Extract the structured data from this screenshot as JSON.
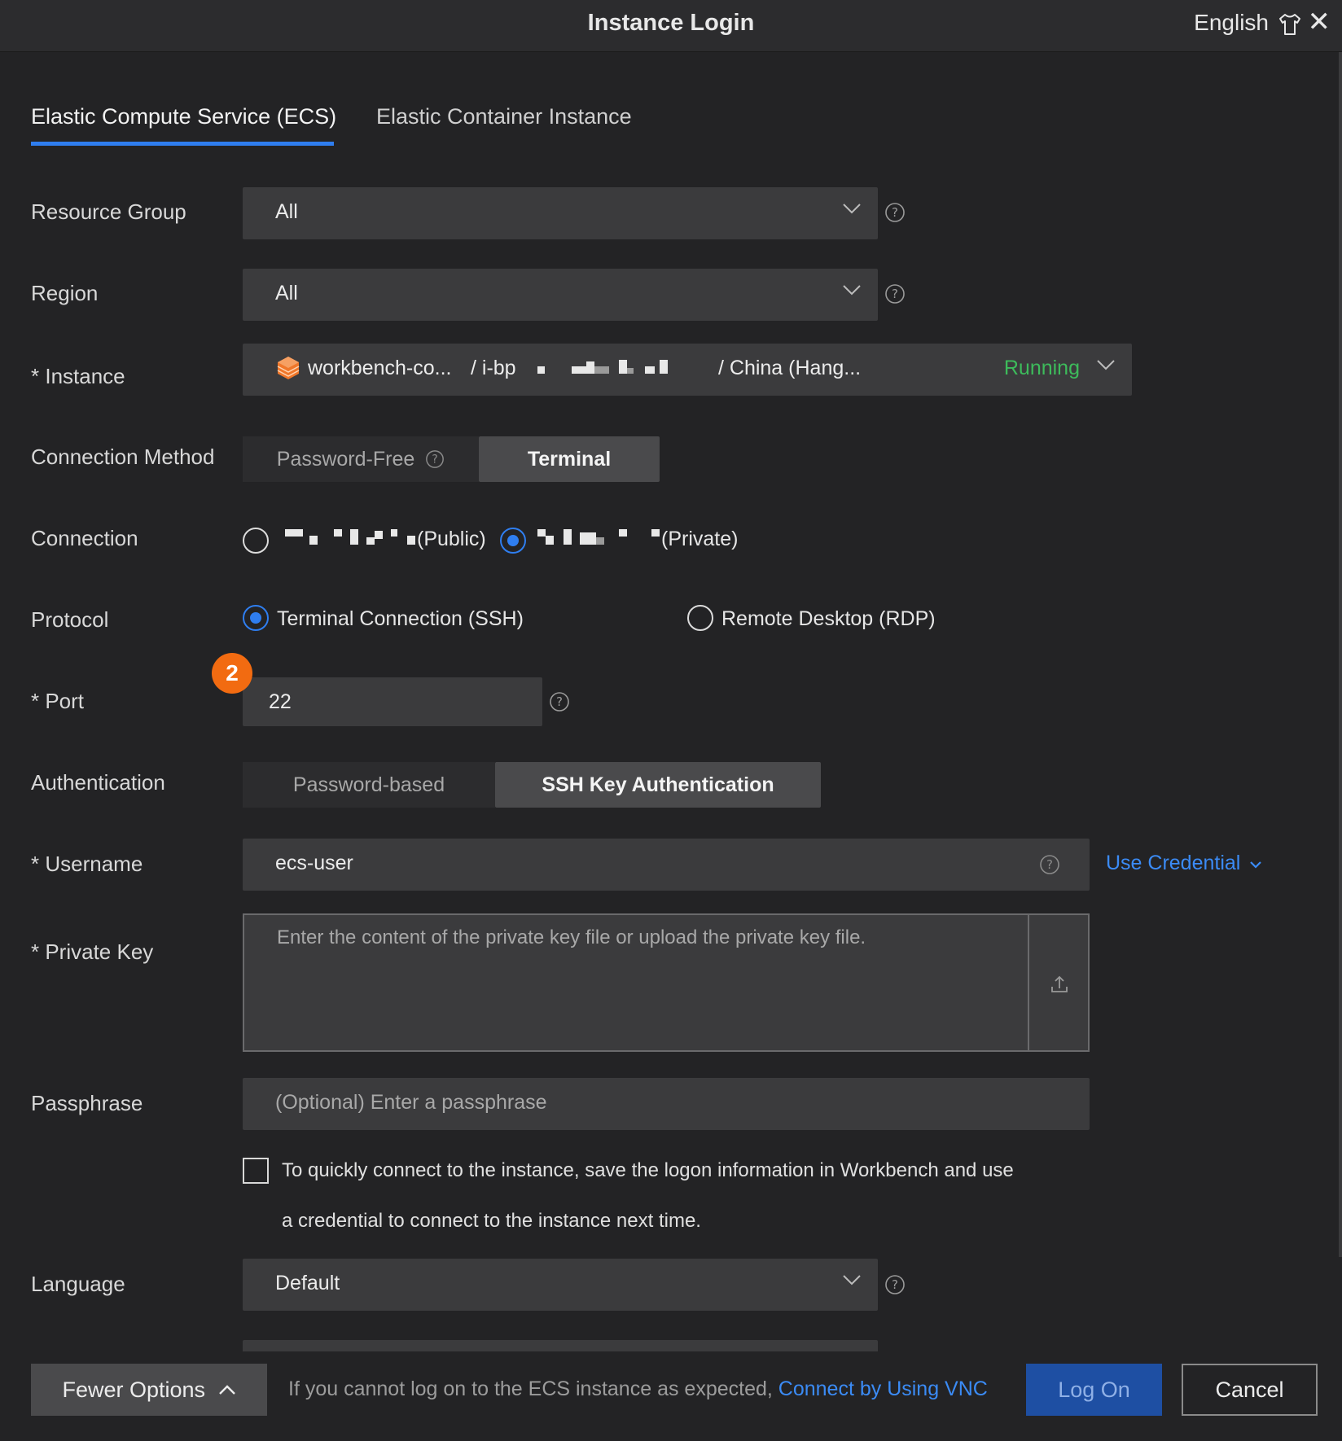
{
  "window": {
    "title": "Instance Login",
    "language": "English"
  },
  "tabs": [
    {
      "label": "Elastic Compute Service (ECS)",
      "active": true
    },
    {
      "label": "Elastic Container Instance",
      "active": false
    }
  ],
  "form": {
    "resource_group": {
      "label": "Resource Group",
      "value": "All"
    },
    "region": {
      "label": "Region",
      "value": "All"
    },
    "instance": {
      "label": "* Instance",
      "name": "workbench-co...",
      "id_prefix": "/ i-bp",
      "region": "/ China (Hang...",
      "status": "Running",
      "status_color": "#3dbb5b"
    },
    "connection_method": {
      "label": "Connection Method",
      "options": [
        "Password-Free",
        "Terminal"
      ],
      "selected": "Terminal"
    },
    "connection": {
      "label": "Connection",
      "public_suffix": "(Public)",
      "private_suffix": "(Private)",
      "selected": "Private"
    },
    "protocol": {
      "label": "Protocol",
      "options": [
        "Terminal Connection (SSH)",
        "Remote Desktop (RDP)"
      ],
      "selected": "Terminal Connection (SSH)"
    },
    "port": {
      "label": "* Port",
      "value": "22",
      "badge": "2"
    },
    "authentication": {
      "label": "Authentication",
      "options": [
        "Password-based",
        "SSH Key Authentication"
      ],
      "selected": "SSH Key Authentication"
    },
    "username": {
      "label": "* Username",
      "value": "ecs-user",
      "credential_link": "Use Credential"
    },
    "private_key": {
      "label": "* Private Key",
      "placeholder": "Enter the content of the private key file or upload the private key file."
    },
    "passphrase": {
      "label": "Passphrase",
      "placeholder": "(Optional) Enter a passphrase"
    },
    "save_info": {
      "line1": "To quickly connect to the instance, save the logon information in Workbench and use",
      "line2": "a credential to connect to the instance next time."
    },
    "language": {
      "label": "Language",
      "value": "Default"
    }
  },
  "footer": {
    "fewer_options": "Fewer Options",
    "help_text": "If you cannot log on to the ECS instance as expected,",
    "vnc_link": "Connect by Using VNC",
    "logon": "Log On",
    "cancel": "Cancel"
  },
  "colors": {
    "accent": "#2f7ef0",
    "background": "#232325",
    "field": "#3b3b3d",
    "badge": "#f26b11"
  }
}
